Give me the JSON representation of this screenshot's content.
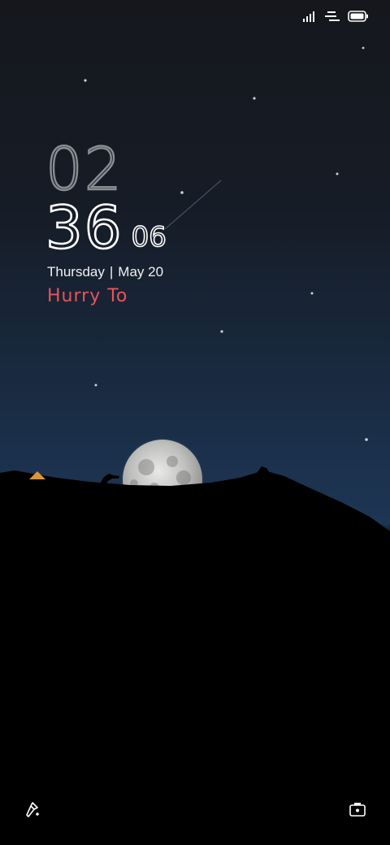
{
  "status": {
    "signal_icon": "signal-bars-icon",
    "data_icon": "data-activity-icon",
    "battery_icon": "battery-icon"
  },
  "clock": {
    "hour": "02",
    "minute": "36",
    "second": "06"
  },
  "date": {
    "weekday": "Thursday",
    "separator": "|",
    "day": "May 20"
  },
  "note": "Hurry To",
  "shortcuts": {
    "left_icon": "flashlight-icon",
    "right_icon": "camera-icon"
  },
  "colors": {
    "note": "#e8545b",
    "sky_top": "#15171c",
    "sky_bottom": "#1d3654"
  }
}
